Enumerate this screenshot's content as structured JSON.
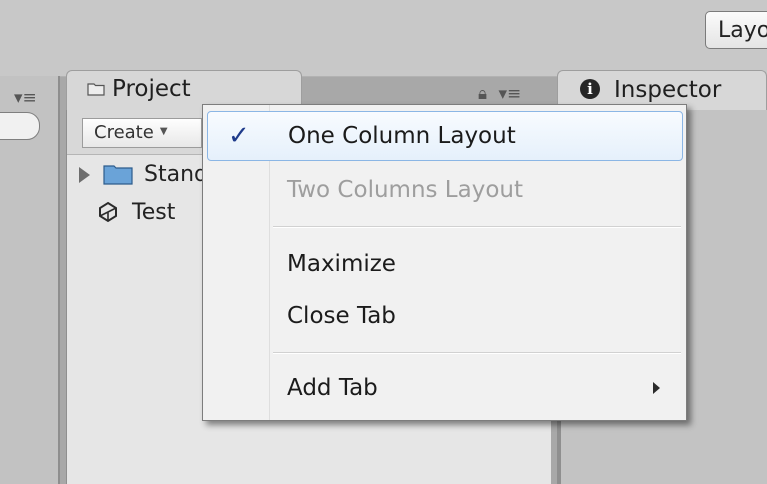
{
  "toolbar": {
    "layout_button_label": "Layout"
  },
  "project": {
    "tab_label": "Project",
    "create_label": "Create",
    "tree_items": [
      "Standard Assets",
      "Test"
    ]
  },
  "inspector": {
    "tab_label": "Inspector",
    "info_icon_glyph": "i"
  },
  "icons": {
    "panel_menu": "panel-menu-icon",
    "lock": "lock-icon",
    "folder": "folder-icon",
    "unity": "unity-scene-icon",
    "info": "info-icon",
    "check": "checkmark-icon",
    "submenu": "submenu-arrow-icon"
  },
  "context_menu": {
    "items": [
      {
        "label": "One Column Layout",
        "checked": true,
        "enabled": true
      },
      {
        "label": "Two Columns Layout",
        "checked": false,
        "enabled": false
      },
      {
        "label": "Maximize",
        "checked": false,
        "enabled": true
      },
      {
        "label": "Close Tab",
        "checked": false,
        "enabled": true
      },
      {
        "label": "Add Tab",
        "checked": false,
        "enabled": true,
        "submenu": true
      }
    ],
    "check_glyph": "✓"
  },
  "colors": {
    "highlight_border": "#8bb6e5",
    "check_color": "#1f3b8b",
    "disabled_text": "#9e9e9e"
  }
}
